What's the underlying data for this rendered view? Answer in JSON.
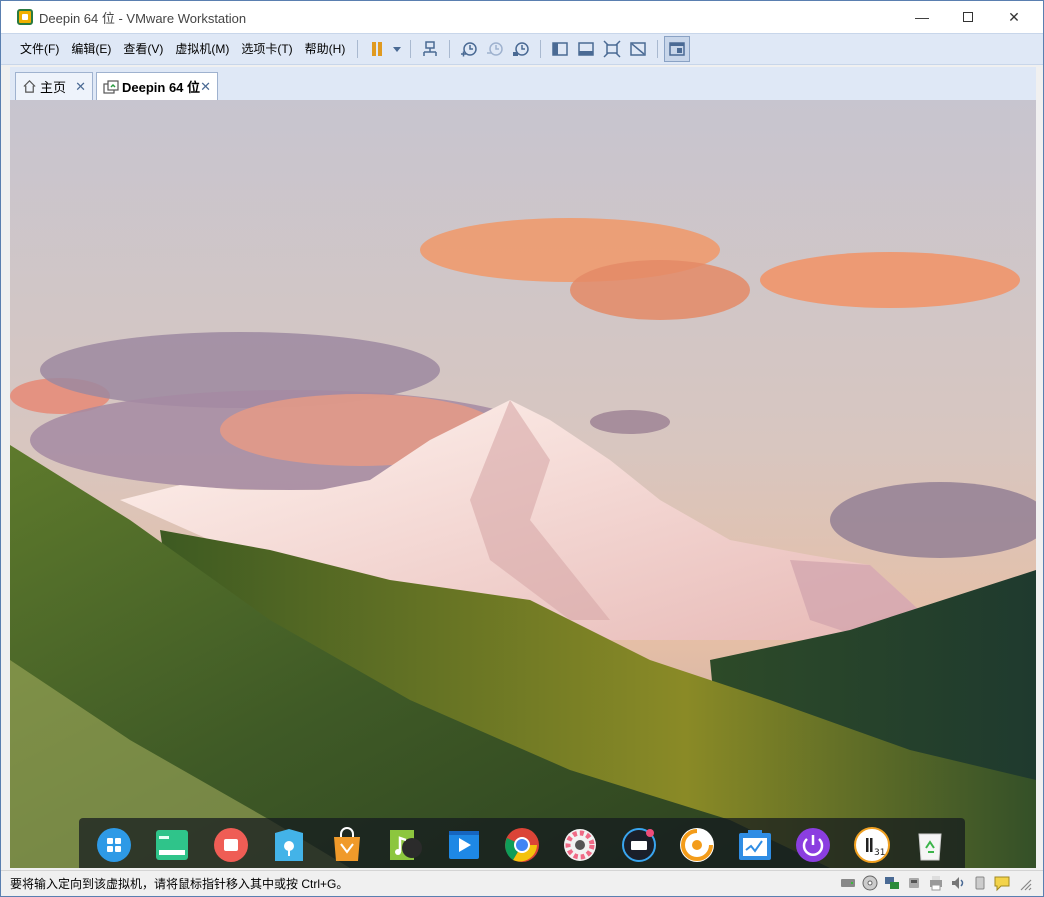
{
  "window": {
    "title": "Deepin 64 位 - VMware Workstation"
  },
  "menu": [
    "文件(F)",
    "编辑(E)",
    "查看(V)",
    "虚拟机(M)",
    "选项卡(T)",
    "帮助(H)"
  ],
  "tabs": [
    {
      "label": "主页",
      "icon": "home-icon"
    },
    {
      "label": "Deepin 64 位",
      "icon": "vm-icon"
    }
  ],
  "status": {
    "message": "要将输入定向到该虚拟机，请将鼠标指针移入其中或按 Ctrl+G。"
  },
  "dock": [
    "launcher-icon",
    "deepin-terminal-icon",
    "screen-recorder-icon",
    "file-manager-icon",
    "app-store-icon",
    "music-icon",
    "movie-icon",
    "chrome-icon",
    "settings-icon",
    "keyboard-icon",
    "browser-icon",
    "system-monitor-icon",
    "power-icon",
    "calendar-icon",
    "trash-icon"
  ],
  "calendar_day": "31",
  "colors": {
    "menubar": "#dfe8f6",
    "accent": "#4a6a94",
    "pause": "#e09a20"
  }
}
